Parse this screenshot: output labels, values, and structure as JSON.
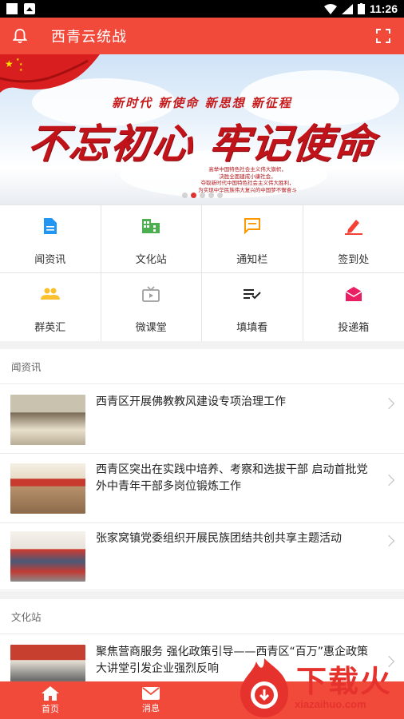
{
  "status_bar": {
    "time": "11:26"
  },
  "app_bar": {
    "title": "西青云统战"
  },
  "banner": {
    "line1": "新时代 新使命 新思想 新征程",
    "slogan": "不忘初心 牢记使命",
    "small_lines": [
      "高举中国特色社会主义伟大旗帜，",
      "决胜全面建成小康社会，",
      "夺取新时代中国特色社会主义伟大胜利，",
      "为实现中华民族伟大复兴的中国梦不懈奋斗"
    ],
    "slide_count": 5,
    "active_slide": 2
  },
  "grid": [
    {
      "label": "闻资讯",
      "icon": "document-icon",
      "color": "#2196f3"
    },
    {
      "label": "文化站",
      "icon": "building-icon",
      "color": "#4caf50"
    },
    {
      "label": "通知栏",
      "icon": "message-icon",
      "color": "#ff9800"
    },
    {
      "label": "签到处",
      "icon": "pen-icon",
      "color": "#f44336"
    },
    {
      "label": "群英汇",
      "icon": "people-icon",
      "color": "#fbc02d"
    },
    {
      "label": "微课堂",
      "icon": "tv-icon",
      "color": "#9e9e9e"
    },
    {
      "label": "填填看",
      "icon": "checklist-icon",
      "color": "#222222"
    },
    {
      "label": "投递箱",
      "icon": "mailbox-icon",
      "color": "#e91e63"
    }
  ],
  "sections": [
    {
      "title": "闻资讯",
      "items": [
        {
          "title": "西青区开展佛教教风建设专项治理工作"
        },
        {
          "title": "西青区突出在实践中培养、考察和选拔干部 启动首批党外中青年干部多岗位锻炼工作"
        },
        {
          "title": "张家窝镇党委组织开展民族团结共创共享主题活动"
        }
      ]
    },
    {
      "title": "文化站",
      "items": [
        {
          "title": "聚焦营商服务 强化政策引导——西青区“百万”惠企政策大讲堂引发企业强烈反响"
        }
      ]
    }
  ],
  "bottom_nav": [
    {
      "label": "首页",
      "icon": "home-icon"
    },
    {
      "label": "消息",
      "icon": "mail-icon"
    }
  ],
  "watermark": {
    "brand": "下载火",
    "url": "xiazaihuo.com"
  }
}
